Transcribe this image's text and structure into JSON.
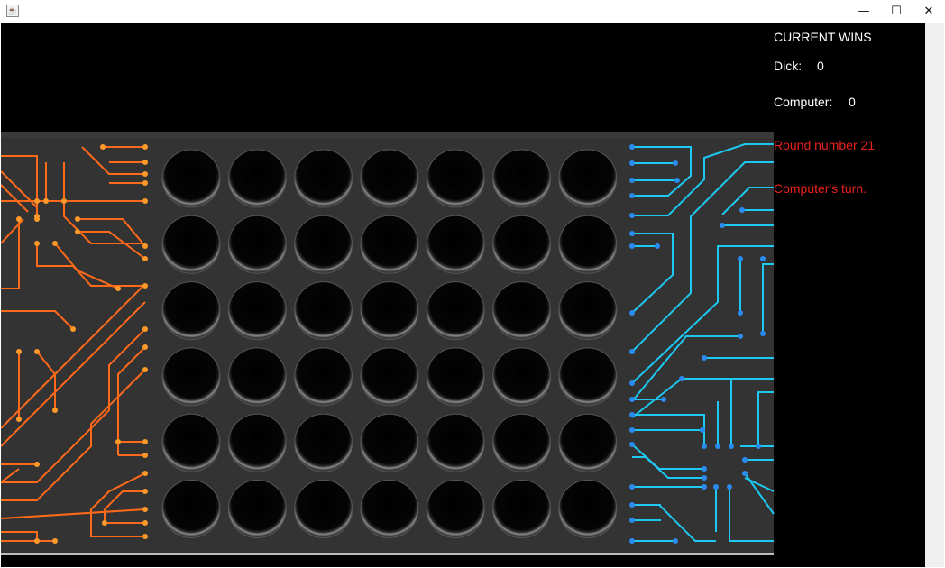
{
  "window": {
    "title": ""
  },
  "wins": {
    "heading": "CURRENT WINS",
    "player1_label": "Dick:",
    "player1_score": "0",
    "player2_label": "Computer:",
    "player2_score": "0"
  },
  "status": {
    "round": "Round number 21",
    "turn": "Computer's turn."
  },
  "board": {
    "columns": 7,
    "rows": 6,
    "filled": []
  },
  "colors": {
    "left_circuit": "#ff6a1a",
    "right_circuit": "#1ec8f0",
    "status_text": "#e8211d",
    "board_bg": "#333333"
  },
  "icons": [
    "java-app-icon",
    "minimize-icon",
    "maximize-icon",
    "close-icon"
  ]
}
